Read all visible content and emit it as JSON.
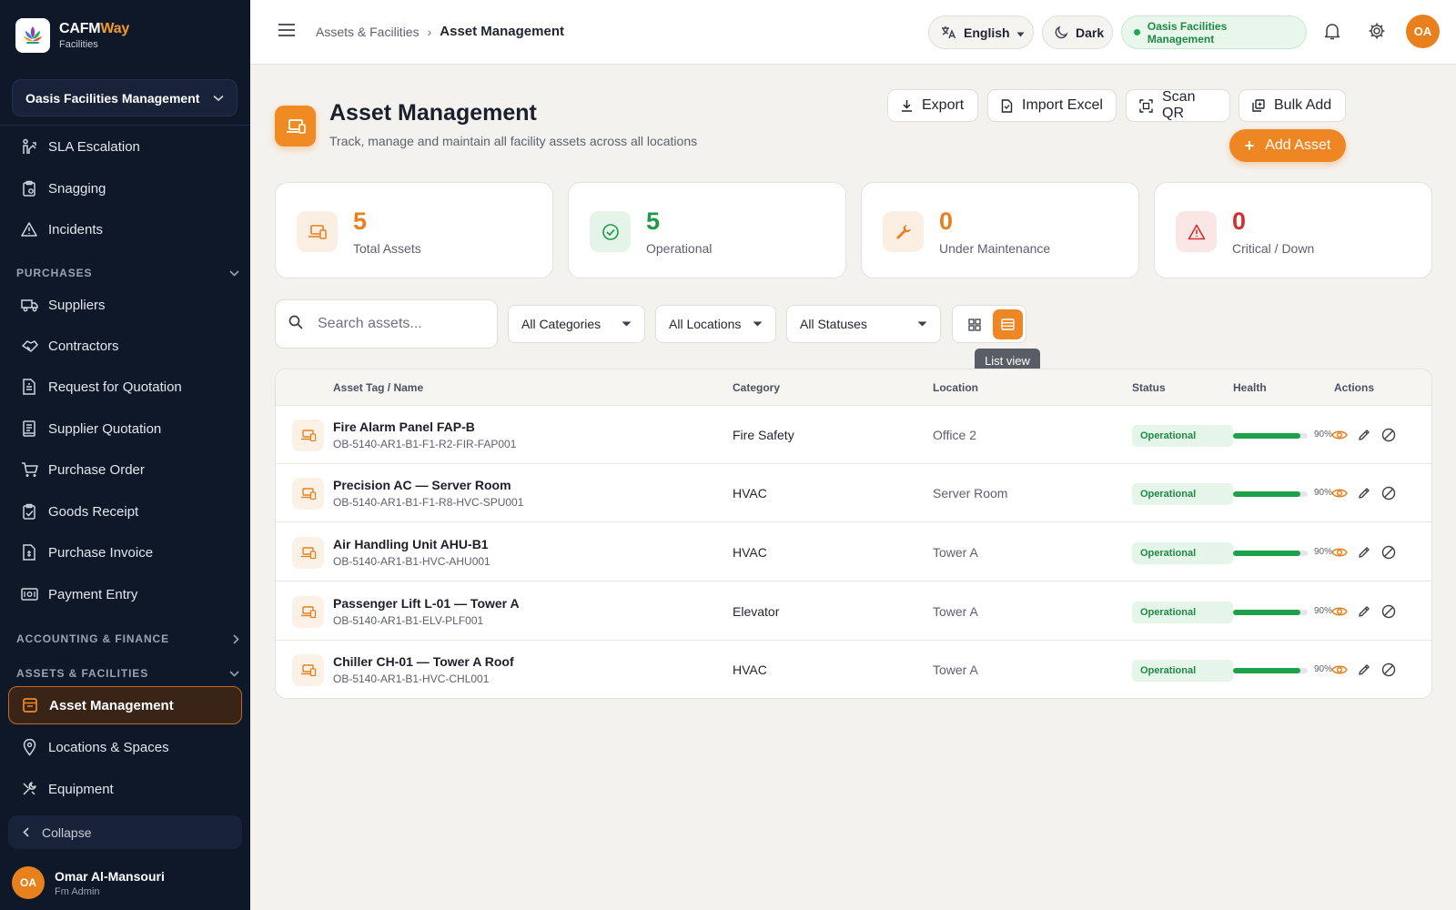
{
  "brand": {
    "name_main": "CAFM",
    "name_accent": "Way",
    "subtitle": "Facilities"
  },
  "sidebar": {
    "org_select": "Oasis Facilities Management",
    "items_top": [
      {
        "label": "SLA Escalation",
        "icon": "escalation-icon"
      },
      {
        "label": "Snagging",
        "icon": "clipboard-icon"
      },
      {
        "label": "Incidents",
        "icon": "warning-icon"
      }
    ],
    "section_purchases": "PURCHASES",
    "purchases": [
      {
        "label": "Suppliers",
        "icon": "truck-icon"
      },
      {
        "label": "Contractors",
        "icon": "handshake-icon"
      },
      {
        "label": "Request for Quotation",
        "icon": "document-icon"
      },
      {
        "label": "Supplier Quotation",
        "icon": "receipt-icon"
      },
      {
        "label": "Purchase Order",
        "icon": "cart-icon"
      },
      {
        "label": "Goods Receipt",
        "icon": "clipboard-check-icon"
      },
      {
        "label": "Purchase Invoice",
        "icon": "invoice-icon"
      },
      {
        "label": "Payment Entry",
        "icon": "payment-icon"
      }
    ],
    "section_accounting": "ACCOUNTING & FINANCE",
    "section_assets": "ASSETS & FACILITIES",
    "assets": [
      {
        "label": "Asset Management",
        "icon": "asset-icon",
        "active": true
      },
      {
        "label": "Locations & Spaces",
        "icon": "location-icon"
      },
      {
        "label": "Equipment",
        "icon": "tools-icon"
      }
    ],
    "collapse_label": "Collapse",
    "user": {
      "initials": "OA",
      "name": "Omar Al-Mansouri",
      "role": "Fm Admin"
    }
  },
  "topbar": {
    "breadcrumb_parent": "Assets & Facilities",
    "breadcrumb_current": "Asset Management",
    "language": "English",
    "theme": "Dark",
    "org_badge": "Oasis Facilities Management",
    "avatar_initials": "OA"
  },
  "page": {
    "title": "Asset Management",
    "subtitle": "Track, manage and maintain all facility assets across all locations",
    "buttons": {
      "export": "Export",
      "import": "Import Excel",
      "scan": "Scan QR",
      "bulk": "Bulk Add",
      "add": "Add Asset"
    }
  },
  "stats": [
    {
      "value": "5",
      "label": "Total Assets",
      "color": "#e8801e",
      "bg": "#fbeee2"
    },
    {
      "value": "5",
      "label": "Operational",
      "color": "#1e9a4a",
      "bg": "#e4f4e9"
    },
    {
      "value": "0",
      "label": "Under Maintenance",
      "color": "#e8801e",
      "bg": "#fbeee2"
    },
    {
      "value": "0",
      "label": "Critical / Down",
      "color": "#d32f2f",
      "bg": "#fbe6e6"
    }
  ],
  "filters": {
    "search_placeholder": "Search assets...",
    "category": "All Categories",
    "location": "All Locations",
    "status": "All Statuses",
    "tooltip": "List view"
  },
  "table": {
    "headers": {
      "name": "Asset Tag / Name",
      "category": "Category",
      "location": "Location",
      "status": "Status",
      "health": "Health",
      "actions": "Actions"
    },
    "rows": [
      {
        "name": "Fire Alarm Panel FAP-B",
        "tag": "OB-5140-AR1-B1-F1-R2-FIR-FAP001",
        "category": "Fire Safety",
        "location": "Office 2",
        "status": "Operational",
        "health": 90,
        "health_label": "90%"
      },
      {
        "name": "Precision AC — Server Room",
        "tag": "OB-5140-AR1-B1-F1-R8-HVC-SPU001",
        "category": "HVAC",
        "location": "Server Room",
        "status": "Operational",
        "health": 90,
        "health_label": "90%"
      },
      {
        "name": "Air Handling Unit AHU-B1",
        "tag": "OB-5140-AR1-B1-HVC-AHU001",
        "category": "HVAC",
        "location": "Tower A",
        "status": "Operational",
        "health": 90,
        "health_label": "90%"
      },
      {
        "name": "Passenger Lift L-01 — Tower A",
        "tag": "OB-5140-AR1-B1-ELV-PLF001",
        "category": "Elevator",
        "location": "Tower A",
        "status": "Operational",
        "health": 90,
        "health_label": "90%"
      },
      {
        "name": "Chiller CH-01 — Tower A Roof",
        "tag": "OB-5140-AR1-B1-HVC-CHL001",
        "category": "HVAC",
        "location": "Tower A",
        "status": "Operational",
        "health": 90,
        "health_label": "90%"
      }
    ]
  }
}
